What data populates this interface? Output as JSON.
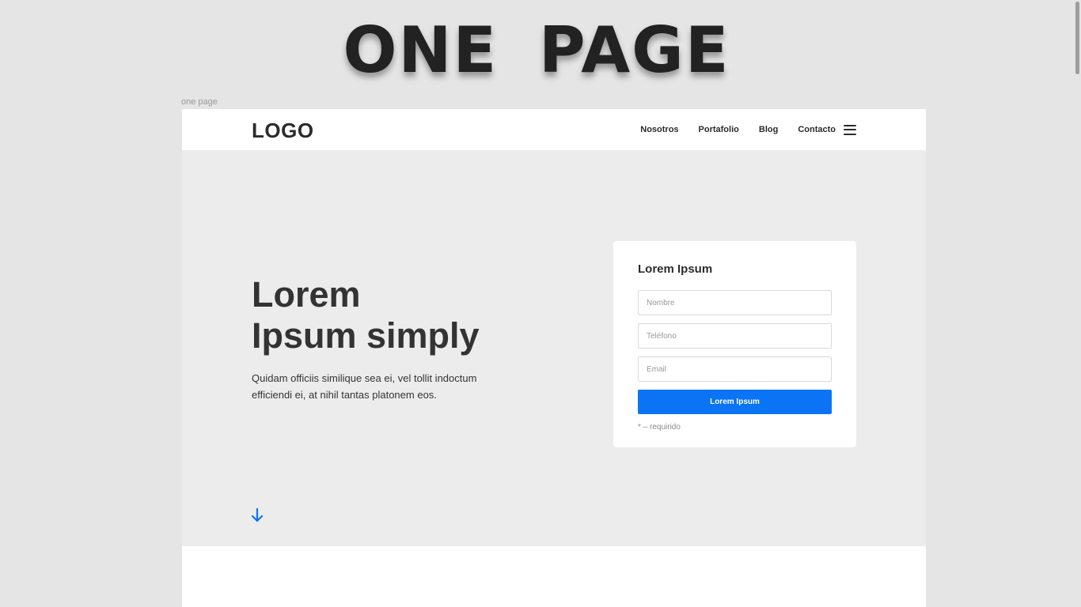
{
  "page": {
    "big_title": "ONE  PAGE",
    "frame_label": "one page"
  },
  "navbar": {
    "logo": "LOGO",
    "links": [
      "Nosotros",
      "Portafolio",
      "Blog",
      "Contacto"
    ]
  },
  "hero": {
    "title_line1": "Lorem",
    "title_line2": "Ipsum simply",
    "text": "Quidam officiis similique sea ei, vel tollit indoctum efficiendi ei, at nihil tantas platonem eos."
  },
  "form": {
    "title": "Lorem Ipsum",
    "name_placeholder": "Nombre",
    "phone_placeholder": "Teléfono",
    "email_placeholder": "Email",
    "submit_label": "Lorem Ipsum",
    "note": "* – requirido"
  },
  "colors": {
    "accent": "#0a74f5",
    "text": "#2b2b2b",
    "hero_bg": "#ececec",
    "page_bg": "#e5e5e5"
  },
  "icons": {
    "menu": "hamburger-icon",
    "scroll": "arrow-down-icon"
  }
}
